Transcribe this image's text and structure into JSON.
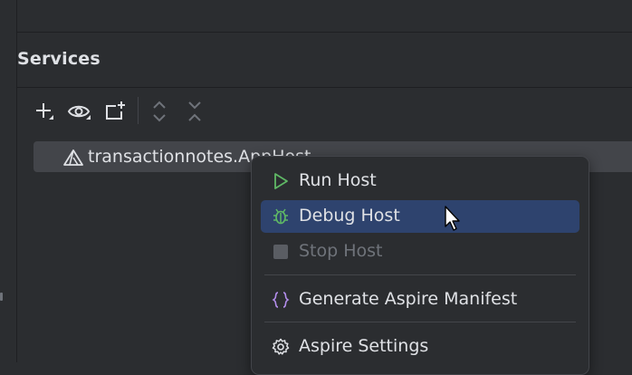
{
  "services": {
    "title": "Services"
  },
  "toolbar": {
    "buttons": [
      "add",
      "view-options",
      "new-tab",
      "expand-all",
      "collapse-all"
    ]
  },
  "tree": {
    "item_label": "transactionnotes.AppHost"
  },
  "context_menu": {
    "items": [
      {
        "label": "Run Host",
        "icon": "run-icon",
        "state": "normal"
      },
      {
        "label": "Debug Host",
        "icon": "debug-icon",
        "state": "selected"
      },
      {
        "label": "Stop Host",
        "icon": "stop-icon",
        "state": "disabled"
      },
      {
        "label": "Generate Aspire Manifest",
        "icon": "braces-icon",
        "state": "normal"
      },
      {
        "label": "Aspire Settings",
        "icon": "gear-icon",
        "state": "normal"
      }
    ]
  },
  "colors": {
    "background": "#2b2d30",
    "selection": "#2e436e",
    "row_highlight": "#43454a",
    "run_green": "#5fb865",
    "braces_purple": "#b48eed"
  }
}
